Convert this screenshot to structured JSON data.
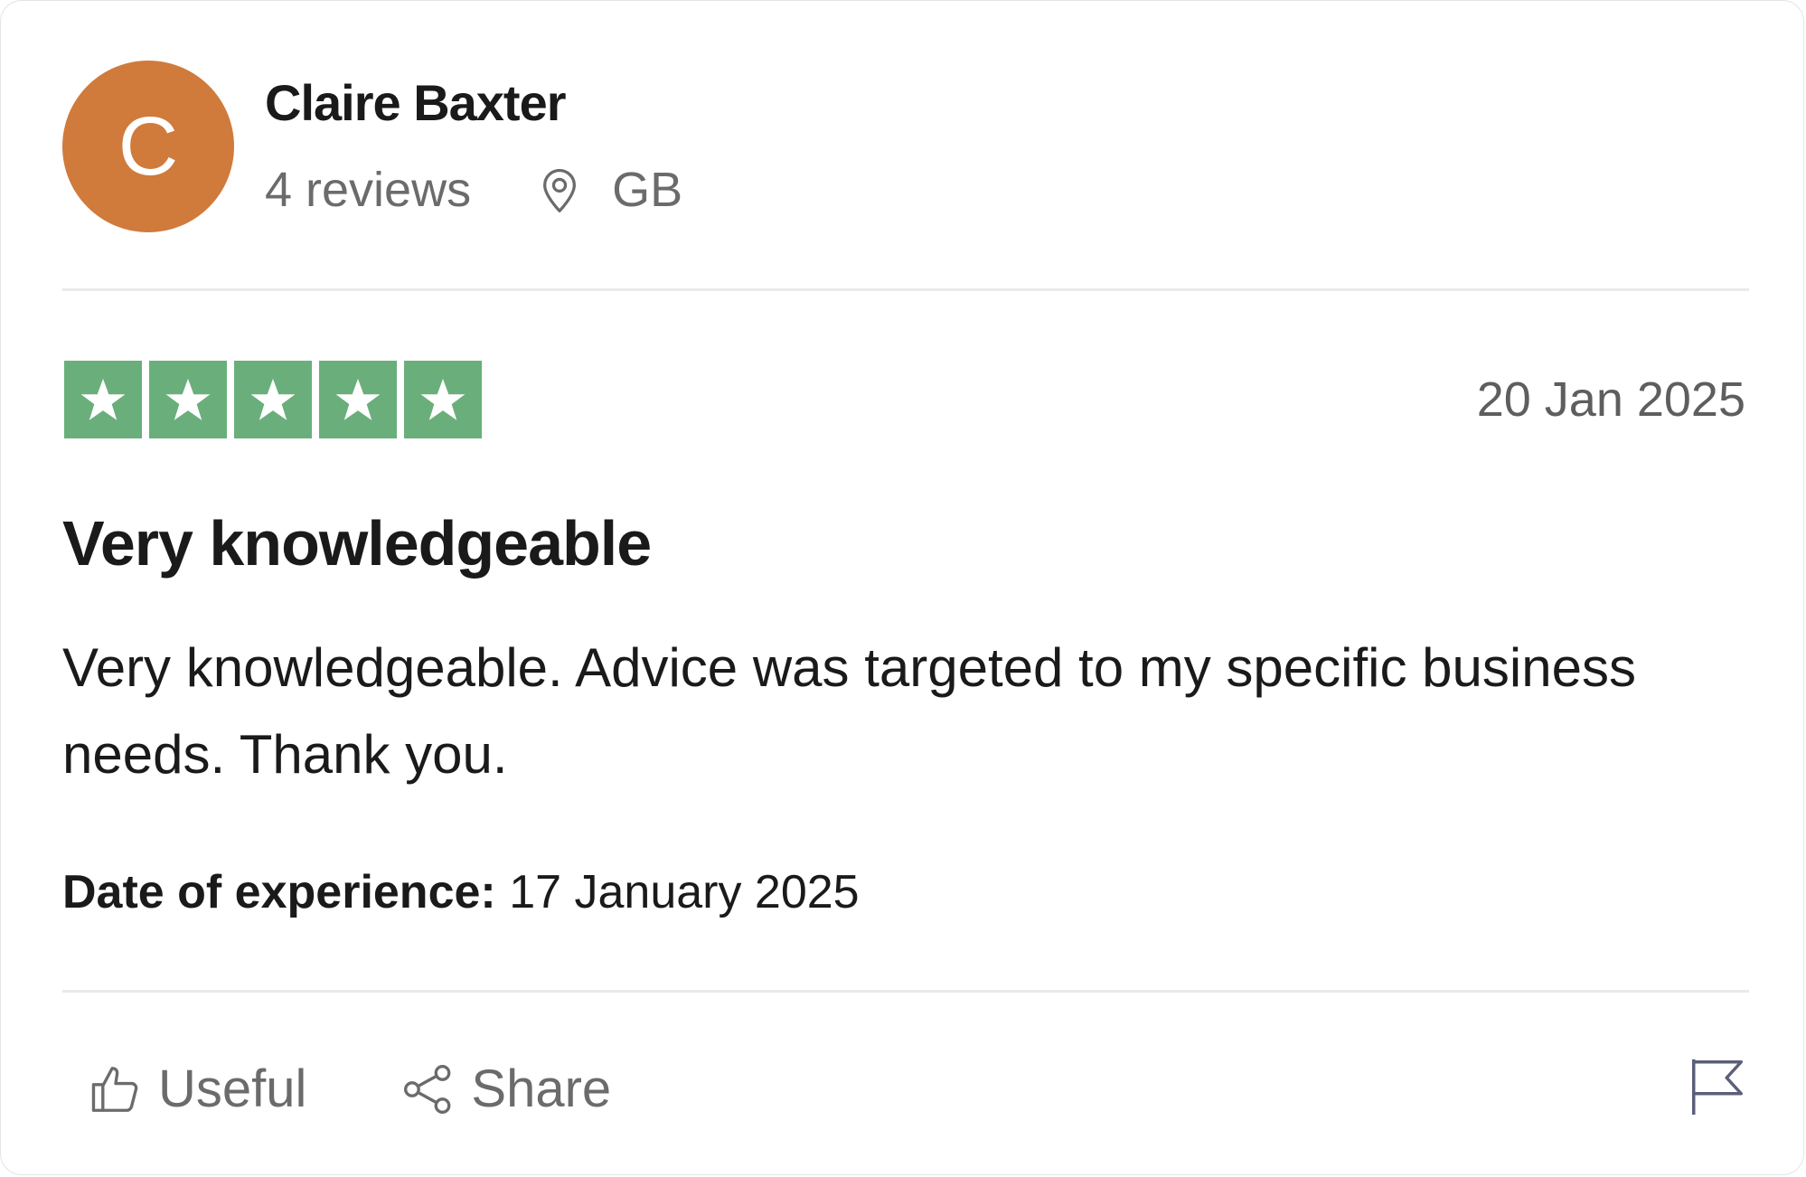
{
  "reviewer": {
    "avatar_initial": "C",
    "avatar_color": "#d07a3c",
    "name": "Claire Baxter",
    "reviews_count": "4 reviews",
    "location_icon": "location-pin-icon",
    "country": "GB"
  },
  "review": {
    "rating": 5,
    "rating_max": 5,
    "star_color": "#6aaf7b",
    "date": "20 Jan 2025",
    "title": "Very knowledgeable",
    "body": "Very knowledgeable. Advice was targeted to my specific business needs. Thank you.",
    "experience_label": "Date of experience:",
    "experience_date": "17 January 2025"
  },
  "actions": {
    "useful_icon": "thumbs-up-icon",
    "useful_label": "Useful",
    "share_icon": "share-icon",
    "share_label": "Share",
    "report_icon": "flag-icon"
  }
}
